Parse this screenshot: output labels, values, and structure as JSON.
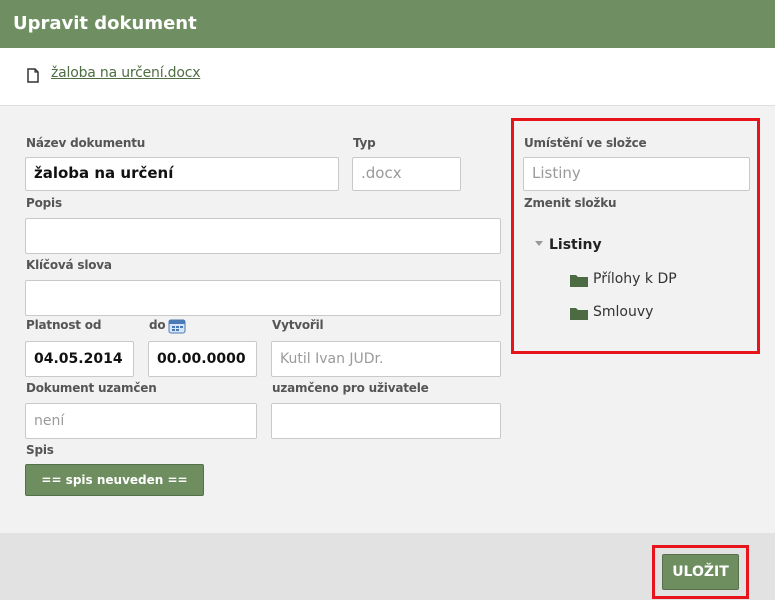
{
  "dialog": {
    "title": "Upravit dokument"
  },
  "file": {
    "link_text": "žaloba na určení.docx"
  },
  "form": {
    "nazev": {
      "label": "Název dokumentu",
      "value": "žaloba na určení"
    },
    "typ": {
      "label": "Typ",
      "placeholder": ".docx"
    },
    "popis": {
      "label": "Popis",
      "value": ""
    },
    "klicova": {
      "label": "Klíčová slova",
      "value": ""
    },
    "platnost_od": {
      "label": "Platnost od",
      "value": "04.05.2014"
    },
    "platnost_do": {
      "label": "do",
      "value": "00.00.0000"
    },
    "vytvoril": {
      "label": "Vytvořil",
      "placeholder": "Kutil Ivan  JUDr."
    },
    "uzamcen": {
      "label": "Dokument uzamčen",
      "placeholder": "není"
    },
    "uzamceno_pro": {
      "label": "uzamčeno pro uživatele",
      "value": ""
    },
    "spis": {
      "label": "Spis",
      "button_label": "== spis neuveden =="
    }
  },
  "folder": {
    "label": "Umístění ve složce",
    "placeholder": "Listiny",
    "change_label": "Zmenit složku",
    "tree": {
      "root": "Listiny",
      "children": [
        "Přílohy k DP",
        "Smlouvy"
      ]
    }
  },
  "footer": {
    "save_label": "ULOŽIT"
  },
  "colors": {
    "header": "#6f8f62",
    "button": "#6e8e60",
    "link": "#4f6e44",
    "highlight": "#e8141b"
  },
  "icons": {
    "file": "document-icon",
    "calendar": "calendar-icon",
    "folder": "folder-icon",
    "expand": "triangle-down-icon"
  }
}
